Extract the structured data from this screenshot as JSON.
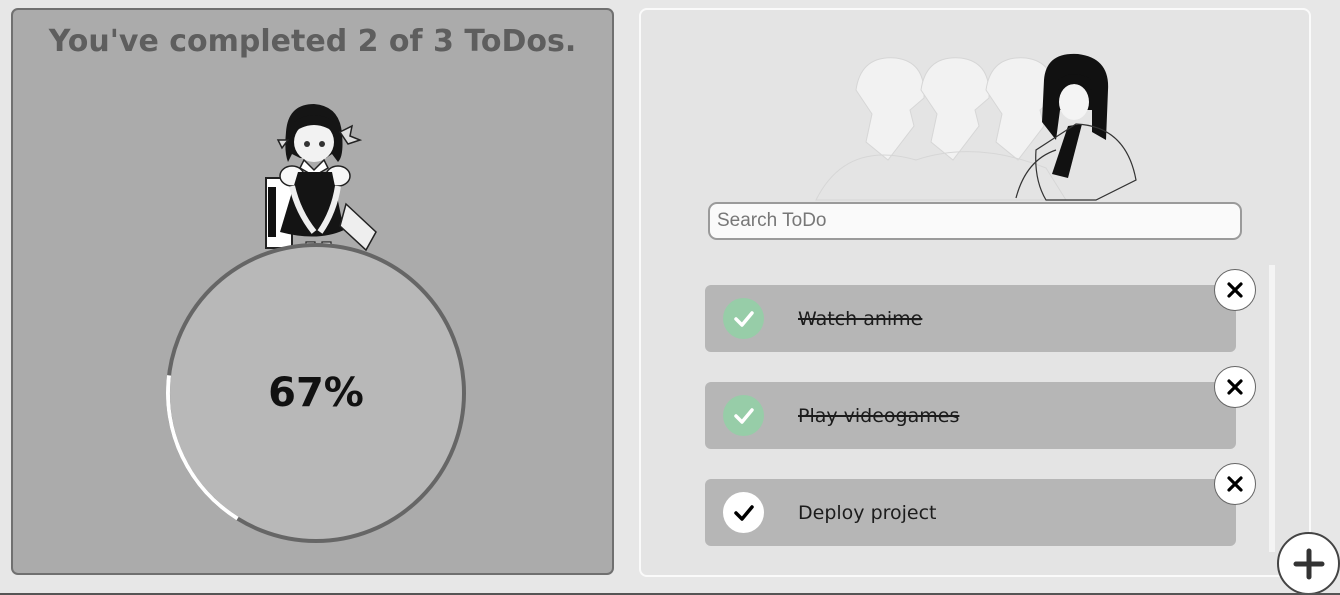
{
  "progress": {
    "title": "You've completed 2 of 3 ToDos.",
    "percent_label": "67%",
    "completed": 2,
    "total": 3,
    "fraction": 0.67
  },
  "search": {
    "placeholder": "Search ToDo",
    "value": ""
  },
  "todos": [
    {
      "label": "Watch anime",
      "completed": true
    },
    {
      "label": "Play videogames",
      "completed": true
    },
    {
      "label": "Deploy project",
      "completed": false
    }
  ],
  "icons": {
    "check": "check-icon",
    "delete": "close-icon",
    "add": "plus-icon"
  },
  "colors": {
    "left_panel_bg": "#ababab",
    "right_panel_bg": "#e4e4e4",
    "done_check": "#97cda8",
    "todo_bg": "#b6b6b6",
    "progress_fill": "#ffffff",
    "progress_track": "#666666"
  }
}
